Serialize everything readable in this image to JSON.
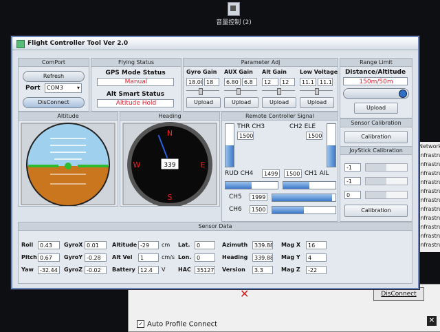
{
  "desktop": {
    "icon_label": "音量控制 (2)"
  },
  "right_list": [
    "Network",
    "Infrastru",
    "Infrastru",
    "Infrastru",
    "Infrastru",
    "Infrastru",
    "Infrastru",
    "Infrastru",
    "Infrastru",
    "Infrastru",
    "Infrastru",
    "Infrastru"
  ],
  "behind": {
    "disconnect": "DisConnect",
    "auto_profile": "Auto Profile Connect",
    "auto_checked": "✓"
  },
  "window": {
    "title": "Flight Controller Tool  Ver 2.0"
  },
  "comport": {
    "header": "ComPort",
    "refresh": "Refresh",
    "port_label": "Port",
    "port_value": "COM3",
    "disconnect": "DisConnect"
  },
  "flying": {
    "header": "Flying Status",
    "gps_title": "GPS Mode Status",
    "gps_value": "Manual",
    "alt_title": "Alt Smart Status",
    "alt_value": "Altitude Hold"
  },
  "params": {
    "header": "Parameter Adj",
    "groups": [
      {
        "label": "Gyro Gain",
        "a": "18.00",
        "b": "18",
        "upload": "Upload",
        "slider": 0.42
      },
      {
        "label": "AUX Gain",
        "a": "6.80",
        "b": "6.8",
        "upload": "Upload",
        "slider": 0.4
      },
      {
        "label": "Alt Gain",
        "a": "12",
        "b": "12",
        "upload": "Upload",
        "slider": 0.5
      },
      {
        "label": "Low Voltage",
        "a": "11.1",
        "b": "11.1",
        "upload": "Upload",
        "slider": 0.5
      }
    ]
  },
  "range": {
    "header": "Range Limit",
    "title": "Distance/Altitude",
    "value": "150m/50m",
    "upload": "Upload"
  },
  "attitude": {
    "header": "Altitude",
    "sky": "#9fd0ee",
    "ground": "#c9761f",
    "bar": "#2fbb2f"
  },
  "heading": {
    "header": "Heading",
    "n": "N",
    "e": "E",
    "s": "S",
    "w": "W",
    "value": "339",
    "needle_deg": 339
  },
  "remote": {
    "header": "Remote Controller Signal",
    "thr_label": "THR CH3",
    "thr_value": "1500",
    "thr_level": 0.5,
    "ele_label": "CH2 ELE",
    "ele_value": "1500",
    "ele_level": 0.5,
    "rud_label": "RUD CH4",
    "rud_value": "1499",
    "rud_level": 0.5,
    "ail_value": "1500",
    "ail_label": "CH1 AIL",
    "ail_level": 0.5,
    "ch5_label": "CH5",
    "ch5_value": "1999",
    "ch5_level": 0.95,
    "ch6_label": "CH6",
    "ch6_value": "1500",
    "ch6_level": 0.5
  },
  "sensor_cal": {
    "header": "Sensor Calibration",
    "button": "Calibration"
  },
  "joystick_cal": {
    "header": "JoyStick Calibration",
    "v1": "-1",
    "v2": "-1",
    "v3": "0",
    "button": "Calibration"
  },
  "sensor": {
    "header": "Sensor Data",
    "roll_l": "Roll",
    "roll": "0.43",
    "pitch_l": "Pitch",
    "pitch": "0.67",
    "yaw_l": "Yaw",
    "yaw": "-32.44",
    "gx_l": "GyroX",
    "gx": "0.01",
    "gy_l": "GyroY",
    "gy": "-0.28",
    "gz_l": "GyroZ",
    "gz": "-0.02",
    "alt_l": "Altitude",
    "alt": "-29",
    "alt_u": "cm",
    "av_l": "Alt Vel",
    "av": "1",
    "av_u": "cm/s",
    "bat_l": "Battery",
    "bat": "12.4",
    "bat_u": "V",
    "lat_l": "Lat.",
    "lat": "0",
    "lon_l": "Lon.",
    "lon": "0",
    "hac_l": "HAC",
    "hac": "35127",
    "az_l": "Azimuth",
    "az": "339.88",
    "hd_l": "Heading",
    "hd": "339.88",
    "ver_l": "Version",
    "ver": "3.3",
    "mx_l": "Mag X",
    "mx": "16",
    "my_l": "Mag Y",
    "my": "4",
    "mz_l": "Mag Z",
    "mz": "-22"
  }
}
